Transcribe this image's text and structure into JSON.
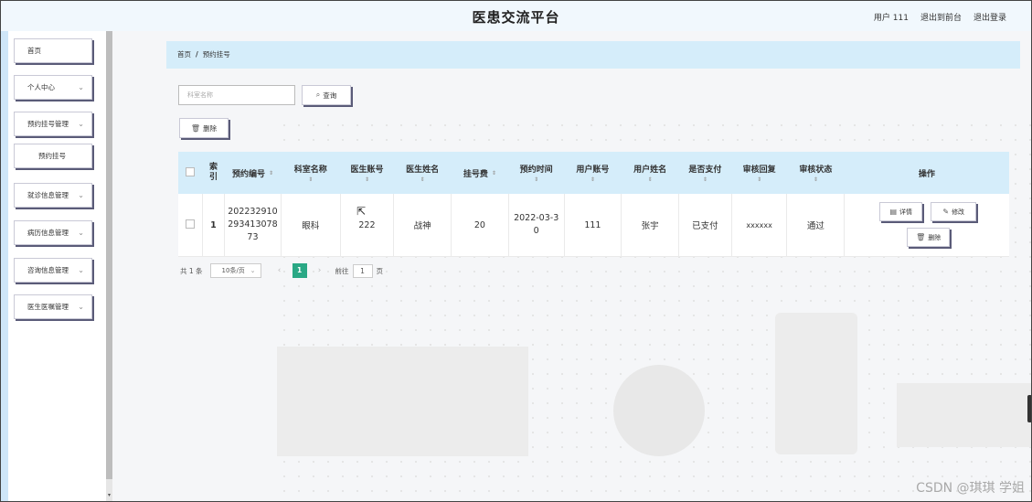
{
  "app": {
    "title": "医患交流平台",
    "user_label": "用户 111",
    "back_to_front": "退出到前台",
    "logout": "退出登录"
  },
  "sidebar": {
    "items": [
      {
        "label": "首页",
        "has_chevron": false
      },
      {
        "label": "个人中心",
        "has_chevron": true
      },
      {
        "label": "预约挂号管理",
        "has_chevron": true
      },
      {
        "label": "预约挂号",
        "has_chevron": false
      },
      {
        "label": "就诊信息管理",
        "has_chevron": true
      },
      {
        "label": "病历信息管理",
        "has_chevron": true
      },
      {
        "label": "咨询信息管理",
        "has_chevron": true
      },
      {
        "label": "医生医嘱管理",
        "has_chevron": true
      }
    ]
  },
  "breadcrumb": {
    "home": "首页",
    "sep": "/",
    "current": "预约挂号"
  },
  "search": {
    "placeholder": "科室名称",
    "button": "查询"
  },
  "toolbar": {
    "delete": "删除"
  },
  "table": {
    "headers": {
      "index": "索引",
      "booking_no": "预约编号",
      "department": "科室名称",
      "doctor_account": "医生账号",
      "doctor_name": "医生姓名",
      "fee": "挂号费",
      "time": "预约时间",
      "user_account": "用户账号",
      "user_name": "用户姓名",
      "paid": "是否支付",
      "reply": "审核回复",
      "status": "审核状态",
      "actions": "操作"
    },
    "rows": [
      {
        "index": "1",
        "booking_no": "20223291029341307873",
        "department": "眼科",
        "doctor_account": "222",
        "doctor_name": "战神",
        "fee": "20",
        "time": "2022-03-30",
        "user_account": "111",
        "user_name": "张宇",
        "paid": "已支付",
        "reply": "xxxxxx",
        "status": "通过",
        "actions": {
          "detail": "详情",
          "edit": "修改",
          "delete": "删除"
        }
      }
    ]
  },
  "pagination": {
    "total": "共 1 条",
    "page_size": "10条/页",
    "current_page": "1",
    "goto_label": "前往",
    "goto_value": "1",
    "page_suffix": "页"
  },
  "watermark": "CSDN @琪琪 学姐",
  "colors": {
    "header_bg": "#f1f8fd",
    "table_header_bg": "#d5edfa",
    "pager_active": "#2aa885",
    "button_shadow": "#5a5b78"
  }
}
